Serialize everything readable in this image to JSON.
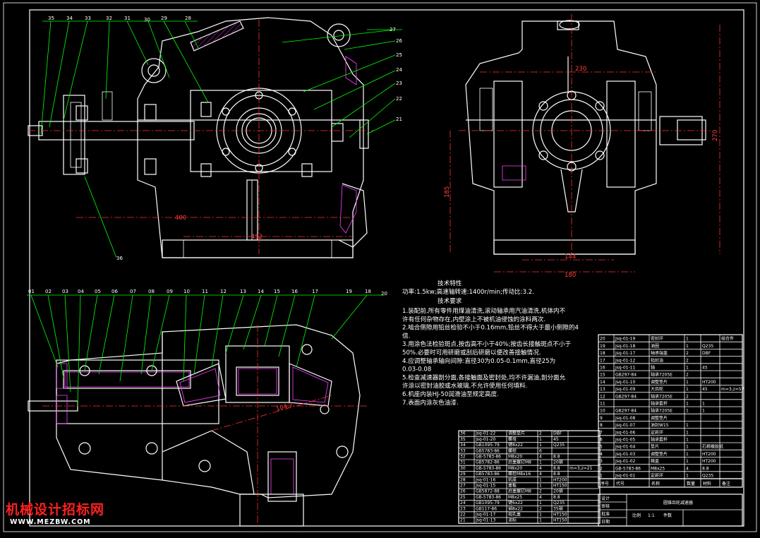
{
  "drawing": {
    "dims_main": [
      "400",
      "492"
    ],
    "dims_side": [
      "230",
      "270",
      "185",
      "144",
      "180"
    ],
    "dim_gear": "104.7",
    "balloons_top": [
      "35",
      "34",
      "33",
      "32",
      "31",
      "30",
      "29",
      "28",
      "27",
      "26",
      "25",
      "24",
      "23",
      "22",
      "21",
      "36"
    ],
    "balloons_bottom": [
      "01",
      "02",
      "03",
      "04",
      "05",
      "06",
      "07",
      "08",
      "09",
      "10",
      "11",
      "12",
      "13",
      "14",
      "15",
      "16",
      "17",
      "18",
      "20",
      "19"
    ]
  },
  "notes": {
    "spec_title": "技术特性",
    "spec_line": "功率:1.5kw;高速轴转速:1400r/min;传动比:3.2.",
    "req_title": "技术要求",
    "lines": [
      "1.装配前,所有零件用煤油清洗,滚动轴承用汽油清洗,机体内不",
      "许有任何杂物存在,内壁涂上不被机油侵蚀的涂料两次.",
      "2.啮合侧隙用铅丝检验不小于0.16mm,铅丝不得大于最小侧隙的4",
      "倍.",
      "3.用涂色法检验斑点,按齿高不小于40%;按齿长接触斑点不小于",
      "50%.必要时可用研磨或刮后研磨以便改善接触情况.",
      "4.应调整轴承轴向间隙:直径30为0.05-0.1mm,直径25为",
      "0.03-0.08",
      "5.检查减速器剖分面,各接触面及密封处,均不许漏油,剖分面允",
      "许涂以密封油胶或水玻璃,不允许使用任何填料.",
      "6.机座内装HJ-50润滑油至规定高度.",
      "7.表面内涂灰色油漆."
    ]
  },
  "bom_right": {
    "rows": [
      [
        "20",
        "Jsq-01-19",
        "密封环",
        "1",
        "",
        "组合件"
      ],
      [
        "19",
        "Jsq-01-18",
        "油圈",
        "1",
        "Q235",
        ""
      ],
      [
        "18",
        "Jsq-01-17",
        "轴承端盖",
        "2",
        "DBF",
        ""
      ],
      [
        "17",
        "Jsq-01-12",
        "毡封油",
        "2",
        "",
        ""
      ],
      [
        "16",
        "Jsq-01-11",
        "轴",
        "1",
        "45",
        ""
      ],
      [
        "15",
        "GB297-84",
        "轴承7205E",
        "2",
        "",
        ""
      ],
      [
        "14",
        "Jsq-01-10",
        "调整垫片",
        "1",
        "HT200",
        ""
      ],
      [
        "13",
        "Jsq-01-09",
        "大齿轮",
        "1",
        "45",
        "m=3,z=57"
      ],
      [
        "12",
        "GB297-84",
        "轴承7205E",
        "2",
        "",
        ""
      ],
      [
        "11",
        "",
        "轴承套杯",
        "1",
        "1",
        ""
      ],
      [
        "10",
        "GB297-84",
        "轴承7205E",
        "1",
        "1",
        ""
      ],
      [
        "9",
        "Jsq-01-08",
        "调整垫片",
        "",
        "",
        ""
      ],
      [
        "8",
        "Jsq-01-07",
        "油封W15",
        "1",
        "",
        ""
      ],
      [
        "7",
        "Jsq-01-06",
        "定距环",
        "1",
        "",
        ""
      ],
      [
        "6",
        "Jsq-01-05",
        "轴承套杯",
        "1",
        "",
        ""
      ],
      [
        "5",
        "Jsq-01-04",
        "垫片",
        "1",
        "石棉橡胶纸",
        ""
      ],
      [
        "4",
        "Jsq-01-03",
        "调整垫片",
        "1",
        "HT200",
        ""
      ],
      [
        "3",
        "Jsq-01-02",
        "箱盖",
        "1",
        "HT200",
        ""
      ],
      [
        "2",
        "GB-5783-86",
        "M8x25",
        "4",
        "8.8",
        ""
      ],
      [
        "1",
        "Jsq-01-01",
        "定距环",
        "1",
        "Q235",
        ""
      ]
    ],
    "header": [
      "序号",
      "代号",
      "名称",
      "数量",
      "材料",
      "备注"
    ],
    "title": "圆锥齿轮减速器",
    "scale_label": "比例",
    "scale_value": "1:1",
    "sheet_label": "件数",
    "design_label": "设计",
    "check_label": "审核",
    "approve_label": "批准",
    "date_label": "日期"
  },
  "bom_left": {
    "rows": [
      [
        "36",
        "Jsq-01-22",
        "调整垫片",
        "2",
        "DBF",
        ""
      ],
      [
        "35",
        "Jsq-01-20",
        "螺母",
        "1",
        "45",
        ""
      ],
      [
        "34",
        "GB1095-79",
        "键8x22",
        "1",
        "Q235",
        ""
      ],
      [
        "33",
        "GB5783-86",
        "螺栓",
        "6",
        "",
        ""
      ],
      [
        "32",
        "GB-5783-86",
        "M8x20",
        "4",
        "8.8",
        ""
      ],
      [
        "31",
        "GB5782-86",
        "启盖螺钉M8",
        "1",
        "20钢",
        ""
      ],
      [
        "30",
        "GB-5783-86",
        "M8x20",
        "4",
        "8.8",
        "m=3,z=21"
      ],
      [
        "29",
        "GB5783-86",
        "螺栓M8x16",
        "4",
        "8.8",
        ""
      ],
      [
        "28",
        "Jsq-01-16",
        "机座",
        "1",
        "HT200",
        ""
      ],
      [
        "27",
        "Jsq-01-15",
        "盖板",
        "1",
        "HT150",
        ""
      ],
      [
        "26",
        "GB5872-88",
        "启盖螺钉M8",
        "2",
        "20钢",
        ""
      ],
      [
        "25",
        "GB-5783-86",
        "M8x25",
        "4",
        "8.8",
        ""
      ],
      [
        "24",
        "GB1095-79",
        "键6x22",
        "1",
        "Q235",
        ""
      ],
      [
        "23",
        "GB117-86",
        "销8x22",
        "2",
        "35钢",
        ""
      ],
      [
        "22",
        "Jsq-01-17",
        "视孔盖",
        "1",
        "HT150",
        ""
      ],
      [
        "21",
        "Jsq-01-13",
        "油标",
        "1",
        "HT150",
        ""
      ]
    ]
  },
  "watermark": {
    "cn": "机械设计招标网",
    "url": "WWW.MEZBW.COM"
  },
  "colors": {
    "background": "#000000",
    "lines": "#ffffff",
    "leaders": "#00ff00",
    "centerlines": "#ff3030",
    "dimensions": "#ff4040",
    "hatch": "#ff40ff",
    "watermark": "#ff2020"
  }
}
